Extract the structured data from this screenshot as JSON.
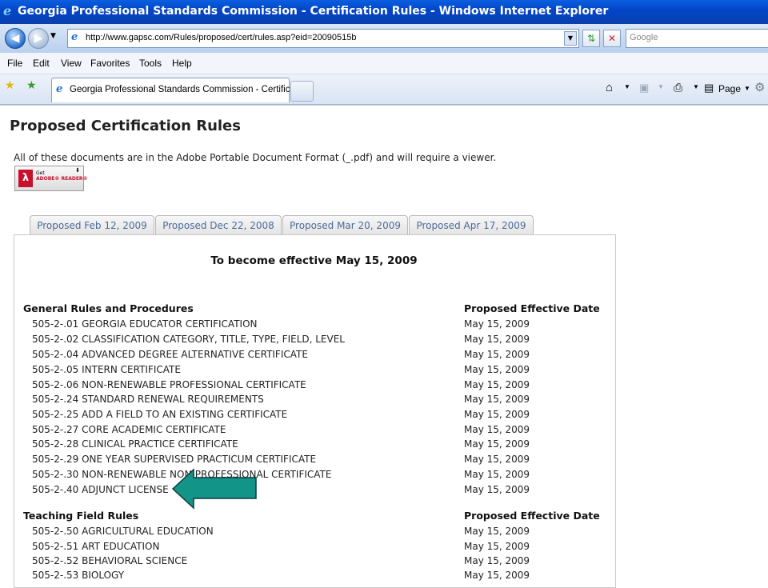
{
  "window": {
    "title": "Georgia Professional Standards Commission - Certification Rules - Windows Internet Explorer"
  },
  "address_bar": {
    "url": "http://www.gapsc.com/Rules/proposed/cert/rules.asp?eid=20090515b",
    "search_placeholder": "Google"
  },
  "menu": [
    "File",
    "Edit",
    "View",
    "Favorites",
    "Tools",
    "Help"
  ],
  "browser_tab": {
    "label": "Georgia Professional Standards Commission - Certifica..."
  },
  "command_bar": {
    "page_label": "Page"
  },
  "page": {
    "title": "Proposed Certification Rules",
    "intro": "All of these documents are in the Adobe Portable Document Format (_.pdf) and will require a viewer.",
    "adobe_badge": {
      "line1": "Get",
      "line2": "ADOBE® READER®"
    },
    "tabs": [
      "Proposed Feb 12, 2009",
      "Proposed Dec 22, 2008",
      "Proposed Mar 20, 2009",
      "Proposed Apr 17, 2009"
    ],
    "effective_heading": "To become effective May 15, 2009",
    "sections": [
      {
        "heading": "General Rules and Procedures",
        "date_header": "Proposed Effective Date",
        "rules": [
          {
            "name": "505-2-.01 GEORGIA EDUCATOR CERTIFICATION",
            "date": "May 15, 2009"
          },
          {
            "name": "505-2-.02 CLASSIFICATION CATEGORY, TITLE, TYPE, FIELD, LEVEL",
            "date": "May 15, 2009"
          },
          {
            "name": "505-2-.04 ADVANCED DEGREE ALTERNATIVE CERTIFICATE",
            "date": "May 15, 2009"
          },
          {
            "name": "505-2-.05 INTERN CERTIFICATE",
            "date": "May 15, 2009"
          },
          {
            "name": "505-2-.06 NON-RENEWABLE PROFESSIONAL CERTIFICATE",
            "date": "May 15, 2009"
          },
          {
            "name": "505-2-.24 STANDARD RENEWAL REQUIREMENTS",
            "date": "May 15, 2009"
          },
          {
            "name": "505-2-.25 ADD A FIELD TO AN EXISTING CERTIFICATE",
            "date": "May 15, 2009"
          },
          {
            "name": "505-2-.27 CORE ACADEMIC CERTIFICATE",
            "date": "May 15, 2009"
          },
          {
            "name": "505-2-.28 CLINICAL PRACTICE CERTIFICATE",
            "date": "May 15, 2009"
          },
          {
            "name": "505-2-.29 ONE YEAR SUPERVISED PRACTICUM CERTIFICATE",
            "date": "May 15, 2009"
          },
          {
            "name": "505-2-.30 NON-RENEWABLE NON-PROFESSIONAL CERTIFICATE",
            "date": "May 15, 2009"
          },
          {
            "name": "505-2-.40 ADJUNCT LICENSE",
            "date": "May 15, 2009"
          }
        ]
      },
      {
        "heading": "Teaching Field Rules",
        "date_header": "Proposed Effective Date",
        "rules": [
          {
            "name": "505-2-.50 AGRICULTURAL EDUCATION",
            "date": "May 15, 2009"
          },
          {
            "name": "505-2-.51 ART EDUCATION",
            "date": "May 15, 2009"
          },
          {
            "name": "505-2-.52 BEHAVIORAL SCIENCE",
            "date": "May 15, 2009"
          },
          {
            "name": "505-2-.53 BIOLOGY",
            "date": "May 15, 2009"
          }
        ]
      }
    ]
  },
  "colors": {
    "titlebar": "#0346c8",
    "arrow": "#139488",
    "tab_text": "#4b6b9a"
  }
}
